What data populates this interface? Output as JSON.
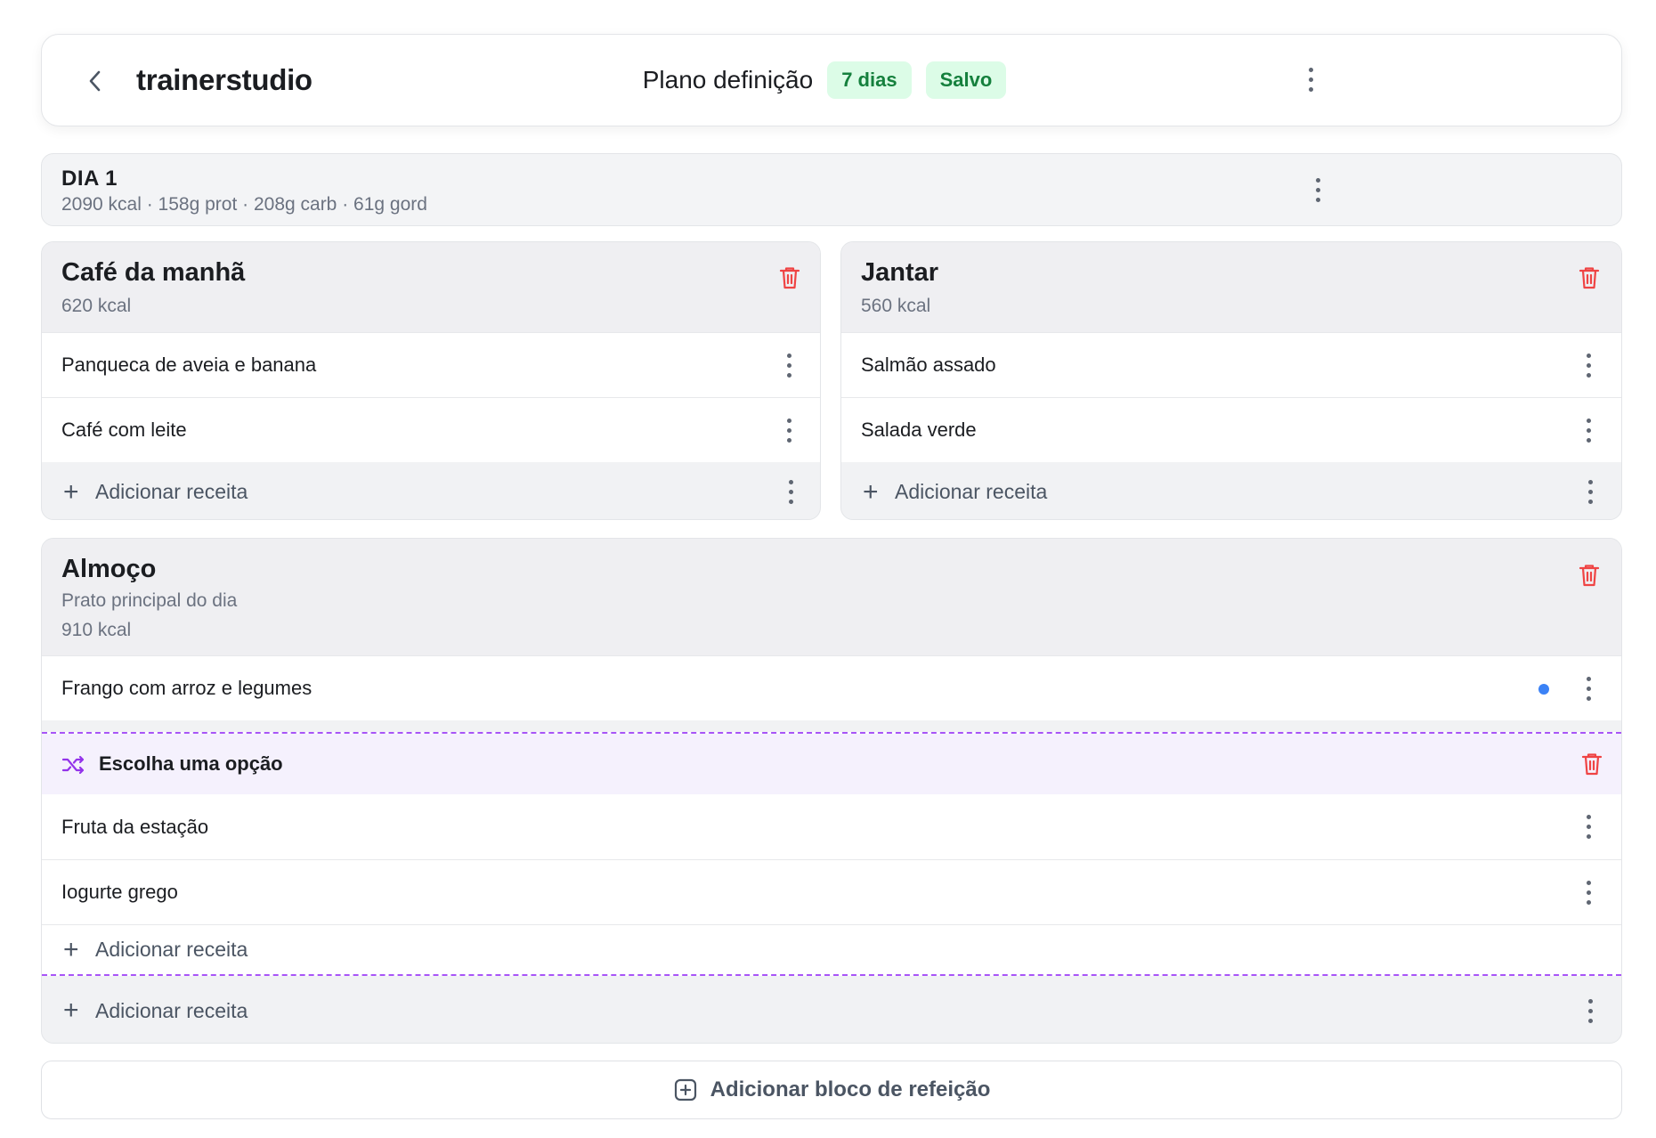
{
  "header": {
    "brand": "trainerstudio",
    "plan_title": "Plano definição",
    "duration_badge": "7 dias",
    "status_badge": "Salvo"
  },
  "day": {
    "title": "DIA 1",
    "macros": "2090 kcal · 158g prot · 208g carb · 61g gord"
  },
  "meals": {
    "breakfast": {
      "name": "Café da manhã",
      "kcal": "620 kcal",
      "items": [
        "Panqueca de aveia e banana",
        "Café com leite"
      ],
      "add_label": "Adicionar receita"
    },
    "dinner": {
      "name": "Jantar",
      "kcal": "560 kcal",
      "items": [
        "Salmão assado",
        "Salada verde"
      ],
      "add_label": "Adicionar receita"
    },
    "lunch": {
      "name": "Almoço",
      "description": "Prato principal do dia",
      "kcal": "910 kcal",
      "items": [
        "Frango com arroz e legumes"
      ],
      "choice": {
        "title": "Escolha uma opção",
        "items": [
          "Fruta da estação",
          "Iogurte grego"
        ],
        "add_label": "Adicionar receita"
      },
      "add_label": "Adicionar receita"
    }
  },
  "footer": {
    "add_block_label": "Adicionar bloco de refeição"
  },
  "colors": {
    "success_bg": "#dcfce7",
    "success_text": "#15803d",
    "danger": "#ef4444",
    "choice_accent": "#a855f7",
    "indicator_blue": "#3b82f6"
  }
}
